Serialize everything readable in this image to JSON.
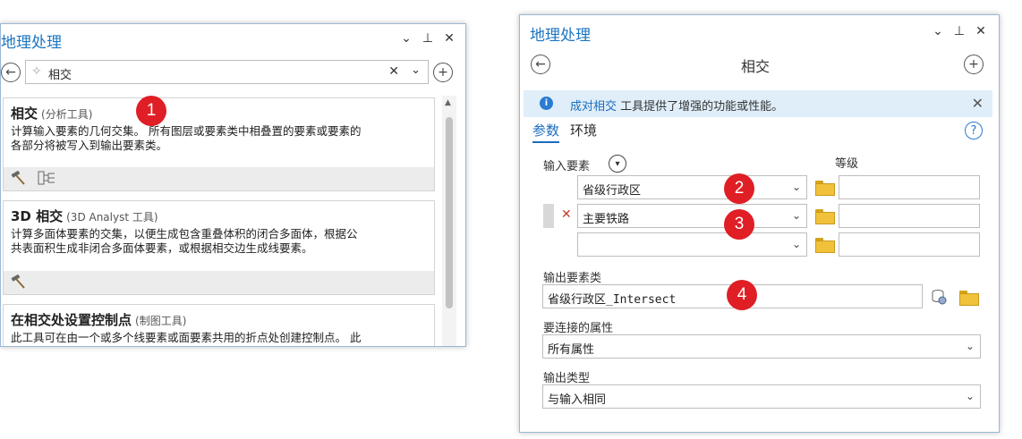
{
  "left_pane": {
    "title": "地理处理",
    "controls": {
      "menu": "⌄",
      "pin": "⊥",
      "close": "✕"
    },
    "back_glyph": "←",
    "add_glyph": "+",
    "search": {
      "value": "相交",
      "clear": "✕",
      "dropdown": "⌄",
      "spark": "✧"
    },
    "results": [
      {
        "title": "相交",
        "category": "(分析工具)",
        "description": "计算输入要素的几何交集。 所有图层或要素类中相叠置的要素或要素的\n各部分将被写入到输出要素类。",
        "footer_icons": [
          "hammer-icon",
          "model-icon"
        ]
      },
      {
        "title": "3D 相交",
        "category": "(3D Analyst 工具)",
        "description": "计算多面体要素的交集，以便生成包含重叠体积的闭合多面体，根据公\n共表面积生成非闭合多面体要素，或根据相交边生成线要素。",
        "footer_icons": [
          "hammer-icon"
        ]
      },
      {
        "title": "在相交处设置控制点",
        "category": "(制图工具)",
        "description": "此工具可在由一个或多个线要素或面要素共用的折点处创建控制点。 此",
        "footer_icons": []
      }
    ]
  },
  "right_pane": {
    "title": "地理处理",
    "controls": {
      "menu": "⌄",
      "pin": "⊥",
      "close": "✕"
    },
    "tool_title": "相交",
    "back_glyph": "←",
    "add_glyph": "+",
    "info": {
      "link": "成对相交",
      "message": " 工具提供了增强的功能或性能。",
      "close": "✕"
    },
    "tabs": [
      "参数",
      "环境"
    ],
    "help": "?",
    "input_features_label": "输入要素",
    "grade_label": "等级",
    "input_rows": [
      {
        "value": "省级行政区",
        "removable": false
      },
      {
        "value": "主要铁路",
        "removable": true
      },
      {
        "value": "",
        "removable": false
      }
    ],
    "output_label": "输出要素类",
    "output_value": "省级行政区_Intersect",
    "join_label": "要连接的属性",
    "join_value": "所有属性",
    "output_type_label": "输出类型",
    "output_type_value": "与输入相同"
  },
  "badges": [
    "1",
    "2",
    "3",
    "4"
  ],
  "colors": {
    "accent": "#1b76c2",
    "badge": "#e01e25",
    "info_bg": "#e0eef9"
  }
}
